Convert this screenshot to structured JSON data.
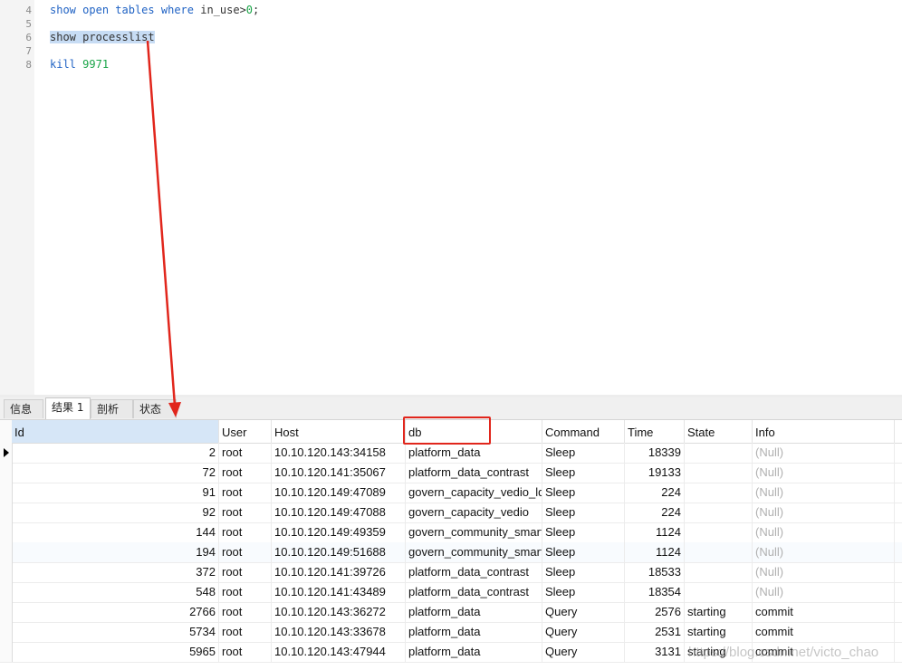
{
  "editor": {
    "lines": [
      {
        "number": "4",
        "tokens": [
          [
            "kw",
            "show"
          ],
          [
            "plain",
            " "
          ],
          [
            "kw",
            "open"
          ],
          [
            "plain",
            " "
          ],
          [
            "kw",
            "tables"
          ],
          [
            "plain",
            " "
          ],
          [
            "kw",
            "where"
          ],
          [
            "plain",
            " in_use>"
          ],
          [
            "num",
            "0"
          ],
          [
            "plain",
            ";"
          ]
        ]
      },
      {
        "number": "5",
        "tokens": []
      },
      {
        "number": "6",
        "tokens": [
          [
            "sel",
            "show processlist"
          ]
        ]
      },
      {
        "number": "7",
        "tokens": []
      },
      {
        "number": "8",
        "tokens": [
          [
            "kw",
            "kill"
          ],
          [
            "plain",
            " "
          ],
          [
            "num",
            "9971"
          ]
        ]
      }
    ]
  },
  "tabs": [
    {
      "label": "信息",
      "active": false
    },
    {
      "label": "结果 1",
      "active": true
    },
    {
      "label": "剖析",
      "active": false
    },
    {
      "label": "状态",
      "active": false
    }
  ],
  "grid": {
    "columns": [
      "Id",
      "User",
      "Host",
      "db",
      "Command",
      "Time",
      "State",
      "Info"
    ],
    "rows": [
      [
        "2",
        "root",
        "10.10.120.143:34158",
        "platform_data",
        "Sleep",
        "18339",
        "",
        "(Null)"
      ],
      [
        "72",
        "root",
        "10.10.120.141:35067",
        "platform_data_contrast",
        "Sleep",
        "19133",
        "",
        "(Null)"
      ],
      [
        "91",
        "root",
        "10.10.120.149:47089",
        "govern_capacity_vedio_lq",
        "Sleep",
        "224",
        "",
        "(Null)"
      ],
      [
        "92",
        "root",
        "10.10.120.149:47088",
        "govern_capacity_vedio",
        "Sleep",
        "224",
        "",
        "(Null)"
      ],
      [
        "144",
        "root",
        "10.10.120.149:49359",
        "govern_community_smart",
        "Sleep",
        "1124",
        "",
        "(Null)"
      ],
      [
        "194",
        "root",
        "10.10.120.149:51688",
        "govern_community_smart",
        "Sleep",
        "1124",
        "",
        "(Null)"
      ],
      [
        "372",
        "root",
        "10.10.120.141:39726",
        "platform_data_contrast",
        "Sleep",
        "18533",
        "",
        "(Null)"
      ],
      [
        "548",
        "root",
        "10.10.120.141:43489",
        "platform_data_contrast",
        "Sleep",
        "18354",
        "",
        "(Null)"
      ],
      [
        "2766",
        "root",
        "10.10.120.143:36272",
        "platform_data",
        "Query",
        "2576",
        "starting",
        "commit"
      ],
      [
        "5734",
        "root",
        "10.10.120.143:33678",
        "platform_data",
        "Query",
        "2531",
        "starting",
        "commit"
      ],
      [
        "5965",
        "root",
        "10.10.120.143:47944",
        "platform_data",
        "Query",
        "3131",
        "starting",
        "commit"
      ]
    ]
  },
  "watermark": "https://blog.csdn.net/victo_chao",
  "colors": {
    "keyword": "#1f62c4",
    "number": "#1aa548",
    "annotation": "#e1261c",
    "selection": "#c7dcf4"
  }
}
